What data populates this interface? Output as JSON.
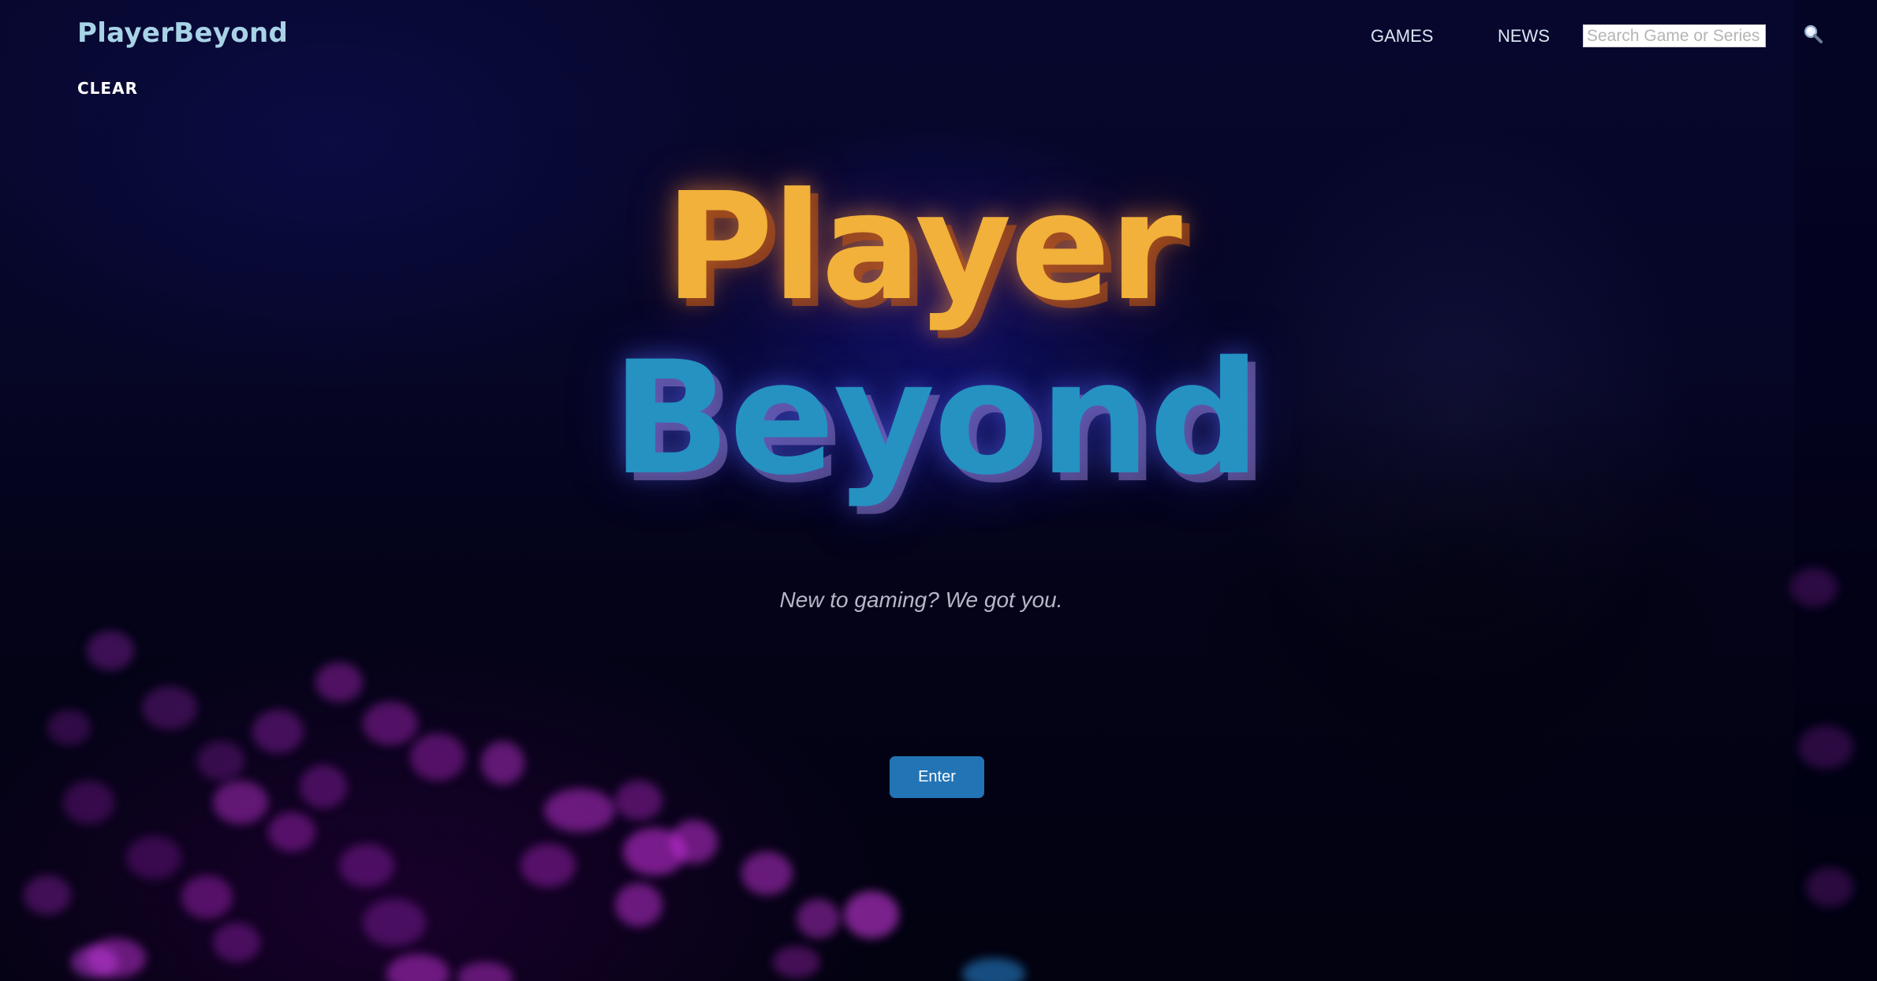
{
  "header": {
    "brand": "PlayerBeyond",
    "clear_label": "CLEAR",
    "nav": {
      "games_label": "GAMES",
      "news_label": "NEWS"
    },
    "search": {
      "placeholder": "Search Game or Series",
      "value": "",
      "icon": "search-icon"
    }
  },
  "hero": {
    "title_line1": "Player",
    "title_line2": "Beyond",
    "tagline": "New to gaming? We got you.",
    "enter_label": "Enter"
  },
  "colors": {
    "brand_text": "#a8d3e6",
    "title_line1": "#f1b13a",
    "title_line2": "#2592c2",
    "enter_button": "#2274b5",
    "background": "#05052a"
  }
}
